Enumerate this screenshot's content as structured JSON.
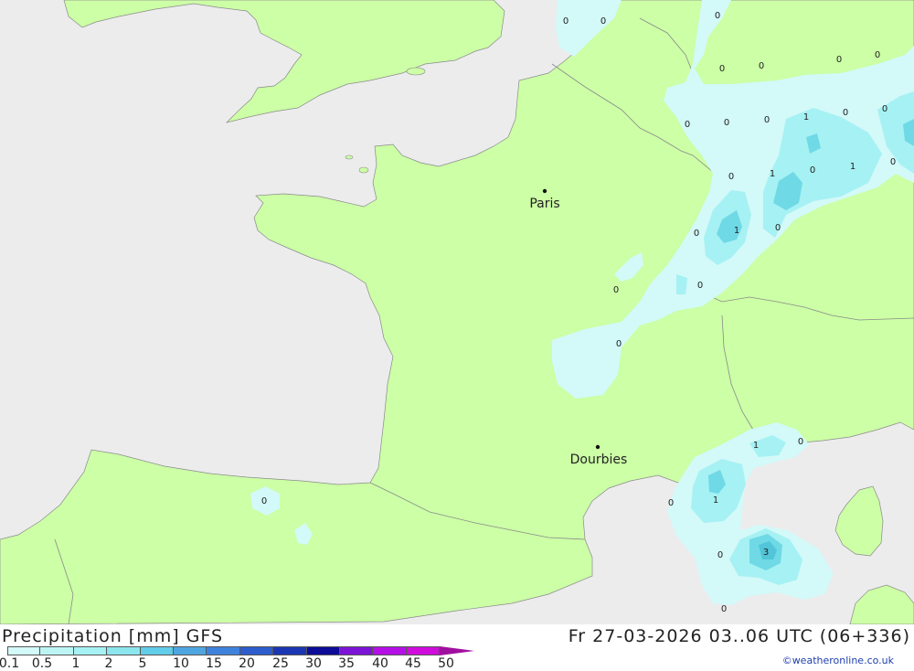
{
  "map": {
    "colors": {
      "sea": "#ececec",
      "land": "#ccffa6",
      "border": "#8a8a8a",
      "precip_light": "#d3f9f9",
      "precip_mid": "#a6f1f3",
      "precip_heavy": "#6fd9e6"
    },
    "cities": [
      {
        "id": "paris",
        "name": "Paris"
      },
      {
        "id": "dourbies",
        "name": "Dourbies"
      }
    ],
    "values": [
      "0",
      "0",
      "0",
      "0",
      "0",
      "0",
      "0",
      "0",
      "0",
      "0",
      "0",
      "1",
      "0",
      "0",
      "0",
      "1",
      "0",
      "1",
      "0",
      "0",
      "0",
      "1",
      "0",
      "0",
      "0",
      "0",
      "0",
      "1",
      "0",
      "0",
      "1",
      "0",
      "3",
      "0",
      "0"
    ]
  },
  "footer": {
    "title": "Precipitation [mm] GFS",
    "datetime": "Fr 27-03-2026 03..06 UTC (06+336)",
    "copyright": "©weatheronline.co.uk",
    "legend": {
      "labels": [
        "0.1",
        "0.5",
        "1",
        "2",
        "5",
        "10",
        "15",
        "20",
        "25",
        "30",
        "35",
        "40",
        "45",
        "50"
      ],
      "colors": [
        "#d3f9f9",
        "#bdf5f5",
        "#a6f1f3",
        "#8ce6ee",
        "#62cde8",
        "#4fa5e0",
        "#3f82dc",
        "#2d5dcc",
        "#1b36b2",
        "#0c0c96",
        "#7c14d6",
        "#b410e6",
        "#d00cdd",
        "#a0109e"
      ]
    }
  }
}
